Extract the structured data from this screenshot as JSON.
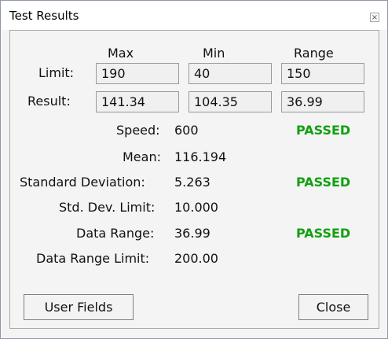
{
  "window": {
    "title": "Test Results",
    "close_glyph": "×"
  },
  "columns": [
    "Max",
    "Min",
    "Range"
  ],
  "rows": [
    {
      "label": "Limit:",
      "max": "190",
      "min": "40",
      "range": "150"
    },
    {
      "label": "Result:",
      "max": "141.34",
      "min": "104.35",
      "range": "36.99"
    }
  ],
  "stats": [
    {
      "label": "Speed:",
      "value": "600",
      "status": "PASSED"
    },
    {
      "label": "Mean:",
      "value": "116.194",
      "status": ""
    },
    {
      "label": "Standard Deviation:",
      "value": "5.263",
      "status": "PASSED"
    },
    {
      "label": "Std. Dev. Limit:",
      "value": "10.000",
      "status": ""
    },
    {
      "label": "Data Range:",
      "value": "36.99",
      "status": "PASSED"
    },
    {
      "label": "Data Range Limit:",
      "value": "200.00",
      "status": ""
    }
  ],
  "buttons": {
    "user_fields": "User Fields",
    "close": "Close"
  },
  "colors": {
    "pass": "#12a012"
  }
}
